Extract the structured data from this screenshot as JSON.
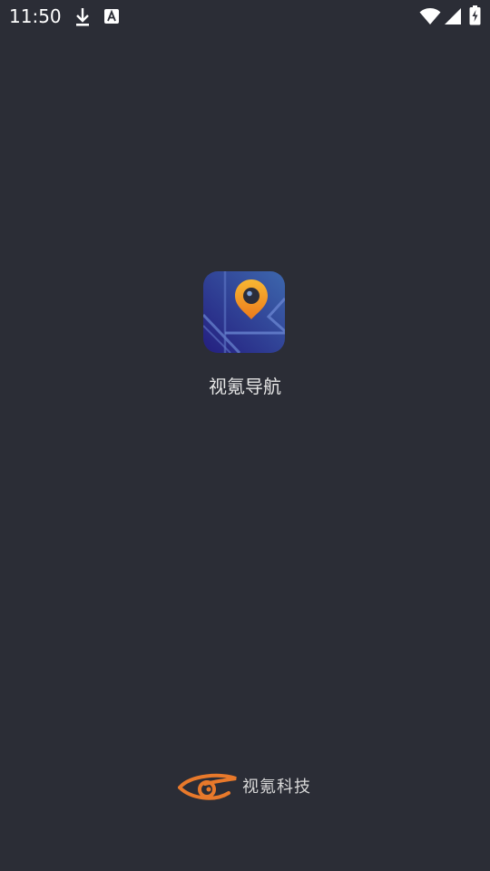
{
  "status_bar": {
    "time": "11:50",
    "icons": [
      "download-icon",
      "font-icon",
      "wifi-icon",
      "cellular-signal-icon",
      "battery-charging-icon"
    ]
  },
  "splash": {
    "app_icon": "map-pin-app-icon",
    "app_name": "视氪导航"
  },
  "footer": {
    "brand_logo": "eye-logo",
    "brand_name": "视氪科技"
  },
  "colors": {
    "background": "#2b2d36",
    "icon_blue_dark": "#27308f",
    "icon_blue_light": "#3a5aa8",
    "pin_orange": "#f5a623",
    "brand_orange": "#e8792b",
    "text": "#e6e6e6"
  }
}
